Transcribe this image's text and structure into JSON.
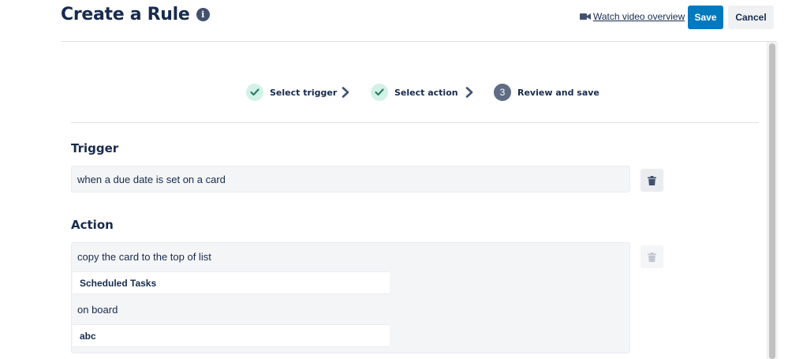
{
  "header": {
    "title": "Create a Rule",
    "info_icon": "info-icon",
    "watch_video_label": "Watch video overview",
    "save_label": "Save",
    "cancel_label": "Cancel"
  },
  "steps": [
    {
      "label": "Select trigger",
      "status": "done",
      "icon": "checkmark-icon"
    },
    {
      "label": "Select action",
      "status": "done",
      "icon": "checkmark-icon"
    },
    {
      "label": "Review and save",
      "status": "current",
      "number": "3"
    }
  ],
  "trigger": {
    "heading": "Trigger",
    "text": "when a due date is set on a card"
  },
  "action": {
    "heading": "Action",
    "line1": "copy the card to the top of list",
    "list_value": "Scheduled Tasks",
    "line2": "on board",
    "board_value": "abc"
  },
  "colors": {
    "primary": "#0079bf",
    "step_done": "#d3f1e7",
    "step_check": "#2d7d6b",
    "step_current": "#5e6c84",
    "text": "#172b4d"
  }
}
